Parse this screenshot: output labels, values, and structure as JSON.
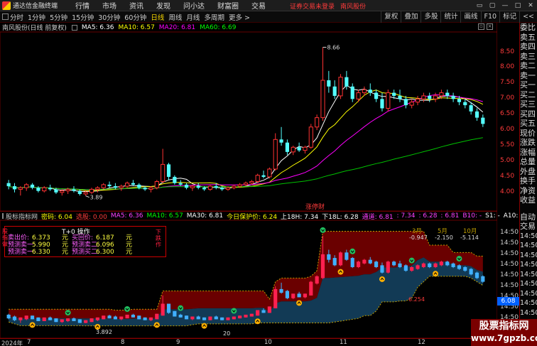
{
  "app": {
    "name": "通达信金融终端",
    "notice": "证券交易未登录",
    "stock_name": "南风股份"
  },
  "menu": [
    "行情",
    "市场",
    "资讯",
    "发现",
    "问小达",
    "财富圈",
    "交易"
  ],
  "window_buttons": [
    "▭",
    "▢",
    "—",
    "□",
    "✕"
  ],
  "toolbar": {
    "periods": [
      "分时",
      "1分钟",
      "5分钟",
      "15分钟",
      "30分钟",
      "60分钟",
      "日线",
      "周线",
      "月线",
      "多周期",
      "更多 >"
    ],
    "active_period": "日线",
    "right_buttons": [
      "复权",
      "叠加",
      "多股",
      "统计",
      "画线",
      "F10",
      "标记",
      "<<"
    ]
  },
  "upper": {
    "title": "南风股份(日线 前复权)",
    "ma5": "MA5: 6.36",
    "ma10": "MA10: 6.57",
    "ma20": "MA20: 6.81",
    "ma60": "MA60: 6.69",
    "high_label": "8.66",
    "low_label": "3.89",
    "event_label": "涨停财",
    "axis": [
      "8.50",
      "8.00",
      "7.50",
      "7.00",
      "6.50",
      "6.00",
      "5.50",
      "5.00",
      "4.50",
      "4.00"
    ]
  },
  "lower": {
    "name": "股标指标网",
    "items": [
      {
        "text": "密码: 6.04",
        "color": "#ffff00"
      },
      {
        "text": "选股: 0.00",
        "color": "#ff3b3b"
      },
      {
        "text": "MA5: 6.36",
        "color": "#ff40ff"
      },
      {
        "text": "MA10: 6.57",
        "color": "#00ff00"
      },
      {
        "text": "MA30: 6.81",
        "color": "#ffffff"
      },
      {
        "text": "今日保护价: 6.24",
        "color": "#ffff00"
      },
      {
        "text": "上18H: 7.34",
        "color": "#ffffff"
      },
      {
        "text": "下18L: 6.28",
        "color": "#ffffff"
      },
      {
        "text": "通道: 6.81",
        "color": "#ff40ff"
      },
      {
        "text": ": 7.34",
        "color": "#ff40ff"
      },
      {
        "text": ": 6.28",
        "color": "#ff40ff"
      },
      {
        "text": ": 6.81",
        "color": "#ff40ff"
      },
      {
        "text": "B10: -",
        "color": "#ff40ff"
      },
      {
        "text": "S1: -",
        "color": "#ffffff"
      },
      {
        "text": "A10: 6.62",
        "color": "#ffffff"
      }
    ],
    "month_labels": [
      {
        "m": "3月",
        "v": "-0.947"
      },
      {
        "m": "5月",
        "v": "-2.150"
      },
      {
        "m": "10月",
        "v": "-5.114"
      }
    ],
    "labels_in_chart": [
      "3.892",
      "6.254",
      "3.89",
      "20"
    ],
    "axis": [
      "14:50",
      "14:50",
      "14:50",
      "14:50",
      "14:50",
      "14:50",
      "14:50",
      "14:50",
      "14:50",
      "14:50"
    ],
    "price_tag": "6.08"
  },
  "t0": {
    "title": "T+0 操作",
    "rows": [
      [
        "卖出价:",
        "6.373",
        "元",
        "买回价:",
        "6.187",
        "元"
      ],
      [
        "预测卖一:",
        "5.990",
        "元",
        "预测卖二:",
        "6.096",
        "元"
      ],
      [
        "预测卖一:",
        "6.330",
        "元",
        "预测买二:",
        "6.300",
        "元"
      ]
    ],
    "side_right": "下跌作",
    "side_left": "股指做"
  },
  "sidepanel": {
    "rows": [
      "委比",
      "卖五",
      "卖四",
      "卖三",
      "卖二",
      "卖一",
      "买一",
      "买二",
      "买三",
      "买四",
      "买五",
      "现价",
      "涨跌",
      "涨幅",
      "总量",
      "外盘",
      "换手",
      "净资",
      "收益"
    ],
    "rows2": [
      "自动",
      "交易",
      "14:50",
      "14:50",
      "14:50",
      "14:50",
      "14:50",
      "14:50",
      "14:50",
      "14:50",
      "14:50",
      "14:50"
    ]
  },
  "xaxis": [
    {
      "t": "2024年",
      "x": 2
    },
    {
      "t": "7",
      "x": 38
    },
    {
      "t": "8",
      "x": 170
    },
    {
      "t": "9",
      "x": 248
    },
    {
      "t": "10",
      "x": 372
    },
    {
      "t": "11",
      "x": 478
    },
    {
      "t": "12",
      "x": 588
    }
  ],
  "watermark": {
    "line1": "股票指标网",
    "line2": "www.7gpzb.com"
  },
  "chart_data": {
    "type": "candlestick",
    "title": "南风股份(日线 前复权)",
    "ylim": [
      3.7,
      8.9
    ],
    "candles": [
      [
        4.3,
        4.4,
        4.1,
        4.2
      ],
      [
        4.2,
        4.3,
        4.0,
        4.1
      ],
      [
        4.1,
        4.2,
        3.9,
        4.15
      ],
      [
        4.15,
        4.3,
        4.05,
        4.25
      ],
      [
        4.25,
        4.3,
        4.1,
        4.15
      ],
      [
        4.15,
        4.2,
        4.0,
        4.05
      ],
      [
        4.05,
        4.2,
        4.0,
        4.15
      ],
      [
        4.15,
        4.25,
        4.05,
        4.1
      ],
      [
        4.1,
        4.15,
        3.95,
        4.0
      ],
      [
        4.0,
        4.1,
        3.9,
        4.05
      ],
      [
        4.05,
        4.15,
        3.95,
        4.1
      ],
      [
        4.1,
        4.2,
        4.0,
        4.05
      ],
      [
        4.05,
        4.1,
        3.9,
        3.95
      ],
      [
        3.95,
        4.05,
        3.89,
        4.0
      ],
      [
        4.0,
        4.15,
        3.95,
        4.1
      ],
      [
        4.1,
        4.2,
        4.0,
        4.15
      ],
      [
        4.15,
        4.3,
        4.1,
        4.25
      ],
      [
        4.25,
        4.35,
        4.15,
        4.2
      ],
      [
        4.2,
        4.3,
        4.1,
        4.15
      ],
      [
        4.15,
        4.25,
        4.05,
        4.2
      ],
      [
        4.2,
        4.35,
        4.15,
        4.3
      ],
      [
        4.3,
        4.4,
        4.2,
        4.25
      ],
      [
        4.25,
        4.3,
        4.1,
        4.15
      ],
      [
        4.15,
        4.2,
        4.05,
        4.1
      ],
      [
        4.1,
        4.2,
        4.0,
        4.15
      ],
      [
        4.15,
        4.4,
        4.1,
        4.35
      ],
      [
        4.35,
        5.4,
        4.3,
        4.9
      ],
      [
        4.9,
        4.95,
        4.4,
        4.5
      ],
      [
        4.5,
        4.55,
        4.25,
        4.3
      ],
      [
        4.3,
        4.4,
        4.2,
        4.25
      ],
      [
        4.25,
        4.3,
        4.1,
        4.15
      ],
      [
        4.15,
        4.25,
        4.05,
        4.2
      ],
      [
        4.2,
        4.3,
        4.1,
        4.15
      ],
      [
        4.15,
        4.2,
        4.05,
        4.1
      ],
      [
        4.1,
        4.25,
        4.05,
        4.2
      ],
      [
        4.2,
        4.3,
        4.1,
        4.15
      ],
      [
        4.15,
        4.2,
        4.05,
        4.1
      ],
      [
        4.1,
        4.2,
        4.05,
        4.15
      ],
      [
        4.15,
        4.25,
        4.1,
        4.2
      ],
      [
        4.2,
        4.3,
        4.15,
        4.25
      ],
      [
        4.25,
        4.35,
        4.2,
        4.3
      ],
      [
        4.3,
        4.4,
        4.25,
        4.35
      ],
      [
        4.35,
        4.6,
        4.3,
        4.55
      ],
      [
        4.55,
        4.7,
        4.45,
        4.5
      ],
      [
        4.5,
        4.8,
        4.45,
        4.75
      ],
      [
        4.75,
        5.9,
        4.7,
        5.7
      ],
      [
        5.7,
        6.1,
        5.5,
        5.6
      ],
      [
        5.6,
        5.7,
        5.2,
        5.3
      ],
      [
        5.3,
        5.5,
        5.2,
        5.45
      ],
      [
        5.45,
        5.6,
        5.3,
        5.35
      ],
      [
        5.35,
        5.5,
        5.25,
        5.45
      ],
      [
        5.45,
        6.2,
        5.4,
        6.1
      ],
      [
        6.1,
        6.5,
        6.0,
        6.4
      ],
      [
        6.4,
        8.66,
        6.3,
        7.6
      ],
      [
        7.6,
        7.9,
        7.2,
        7.4
      ],
      [
        7.4,
        7.6,
        7.0,
        7.1
      ],
      [
        7.1,
        7.8,
        7.0,
        7.7
      ],
      [
        7.7,
        7.9,
        7.3,
        7.4
      ],
      [
        7.4,
        7.5,
        6.9,
        7.0
      ],
      [
        7.0,
        7.3,
        6.9,
        7.2
      ],
      [
        7.2,
        7.4,
        7.1,
        7.3
      ],
      [
        7.3,
        7.5,
        7.1,
        7.2
      ],
      [
        7.2,
        7.3,
        6.9,
        7.0
      ],
      [
        7.0,
        7.2,
        6.6,
        6.7
      ],
      [
        6.7,
        7.3,
        6.6,
        7.2
      ],
      [
        7.2,
        7.3,
        7.0,
        7.1
      ],
      [
        7.1,
        7.3,
        6.9,
        7.0
      ],
      [
        7.0,
        7.1,
        6.7,
        6.8
      ],
      [
        6.8,
        7.0,
        6.7,
        6.9
      ],
      [
        6.9,
        7.1,
        6.8,
        7.0
      ],
      [
        7.0,
        7.2,
        6.9,
        7.1
      ],
      [
        7.1,
        7.2,
        6.9,
        7.0
      ],
      [
        7.0,
        7.2,
        6.9,
        7.1
      ],
      [
        7.1,
        7.3,
        7.0,
        7.2
      ],
      [
        7.2,
        7.3,
        7.0,
        7.1
      ],
      [
        7.1,
        7.2,
        6.9,
        7.0
      ],
      [
        7.0,
        7.1,
        6.8,
        6.9
      ],
      [
        6.9,
        7.0,
        6.7,
        6.8
      ],
      [
        6.8,
        6.9,
        6.5,
        6.6
      ],
      [
        6.6,
        6.7,
        6.3,
        6.4
      ],
      [
        6.4,
        6.5,
        6.1,
        6.2
      ]
    ]
  }
}
